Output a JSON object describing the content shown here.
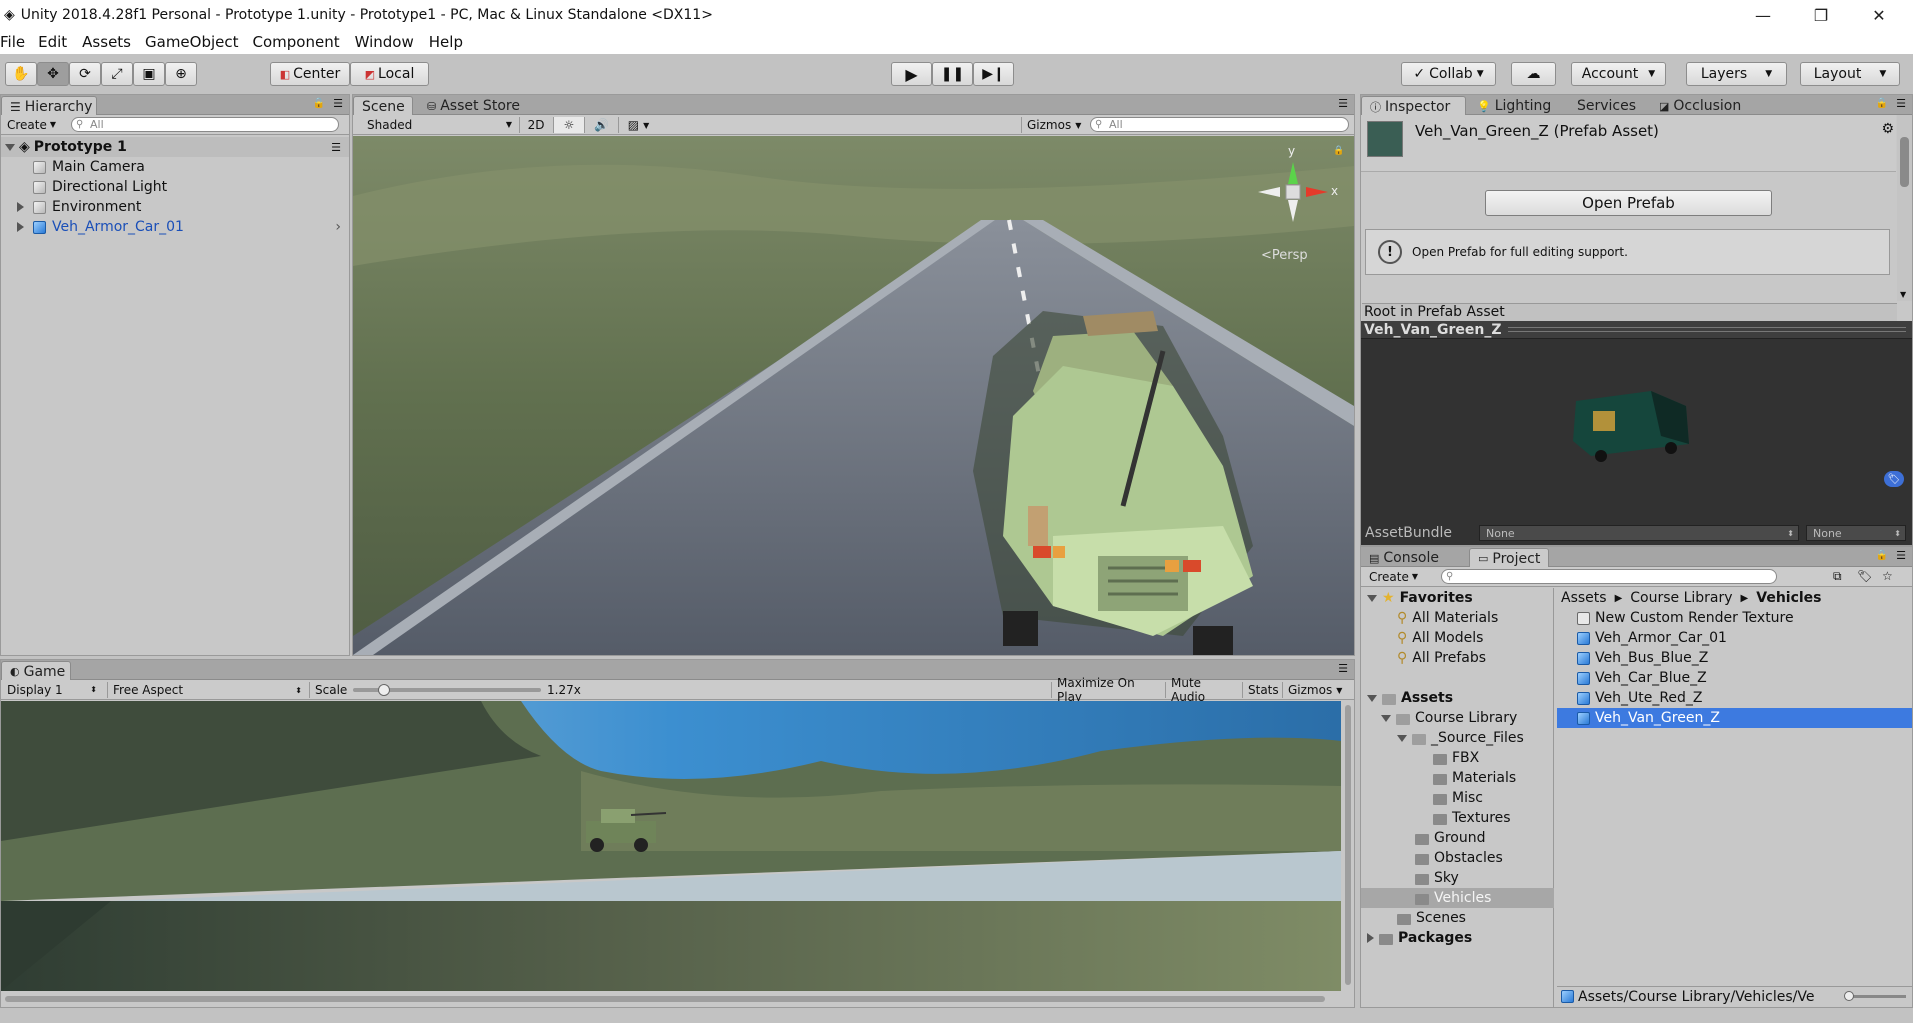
{
  "window": {
    "title": "Unity 2018.4.28f1 Personal - Prototype 1.unity - Prototype1 - PC, Mac & Linux Standalone <DX11>",
    "minimize": "—",
    "restore": "❐",
    "close": "✕"
  },
  "menu": [
    "File",
    "Edit",
    "Assets",
    "GameObject",
    "Component",
    "Window",
    "Help"
  ],
  "toolbar": {
    "center_label": "Center",
    "local_label": "Local",
    "collab_label": "Collab",
    "account_label": "Account",
    "layers_label": "Layers",
    "layout_label": "Layout"
  },
  "hierarchy": {
    "tab": "Hierarchy",
    "create_label": "Create",
    "search_placeholder": "All",
    "scene_name": "Prototype 1",
    "items": [
      {
        "label": "Main Camera"
      },
      {
        "label": "Directional Light"
      },
      {
        "label": "Environment"
      },
      {
        "label": "Veh_Armor_Car_01"
      }
    ]
  },
  "scene": {
    "tab": "Scene",
    "asset_store_tab": "Asset Store",
    "shading": "Shaded",
    "mode_2d": "2D",
    "gizmos": "Gizmos",
    "search_placeholder": "All",
    "persp": "Persp",
    "axis_x": "x",
    "axis_y": "y"
  },
  "game": {
    "tab": "Game",
    "display": "Display 1",
    "aspect": "Free Aspect",
    "scale_label": "Scale",
    "scale_value": "1.27x",
    "scale_fraction": 0.14,
    "maximize": "Maximize On Play",
    "mute": "Mute Audio",
    "stats": "Stats",
    "gizmos": "Gizmos"
  },
  "inspector": {
    "tabs": [
      "Inspector",
      "Lighting",
      "Services",
      "Occlusion"
    ],
    "asset_name": "Veh_Van_Green_Z (Prefab Asset)",
    "open_prefab": "Open Prefab",
    "info_text": "Open Prefab for full editing support.",
    "root_label": "Root in Prefab Asset",
    "preview_title": "Veh_Van_Green_Z",
    "assetbundle_label": "AssetBundle",
    "assetbundle_value": "None",
    "assetbundle_variant": "None"
  },
  "project": {
    "tabs": [
      "Console",
      "Project"
    ],
    "create_label": "Create",
    "favorites": {
      "label": "Favorites",
      "items": [
        "All Materials",
        "All Models",
        "All Prefabs"
      ]
    },
    "tree": {
      "assets": "Assets",
      "course_library": "Course Library",
      "source_files": "_Source_Files",
      "sub": [
        "FBX",
        "Materials",
        "Misc",
        "Textures"
      ],
      "folders": [
        "Ground",
        "Obstacles",
        "Sky",
        "Vehicles"
      ],
      "scenes": "Scenes",
      "packages": "Packages"
    },
    "breadcrumb": [
      "Assets",
      "Course Library",
      "Vehicles"
    ],
    "files": [
      "New Custom Render Texture",
      "Veh_Armor_Car_01",
      "Veh_Bus_Blue_Z",
      "Veh_Car_Blue_Z",
      "Veh_Ute_Red_Z",
      "Veh_Van_Green_Z"
    ],
    "selected_file": "Veh_Van_Green_Z",
    "path": "Assets/Course Library/Vehicles/Ve"
  }
}
